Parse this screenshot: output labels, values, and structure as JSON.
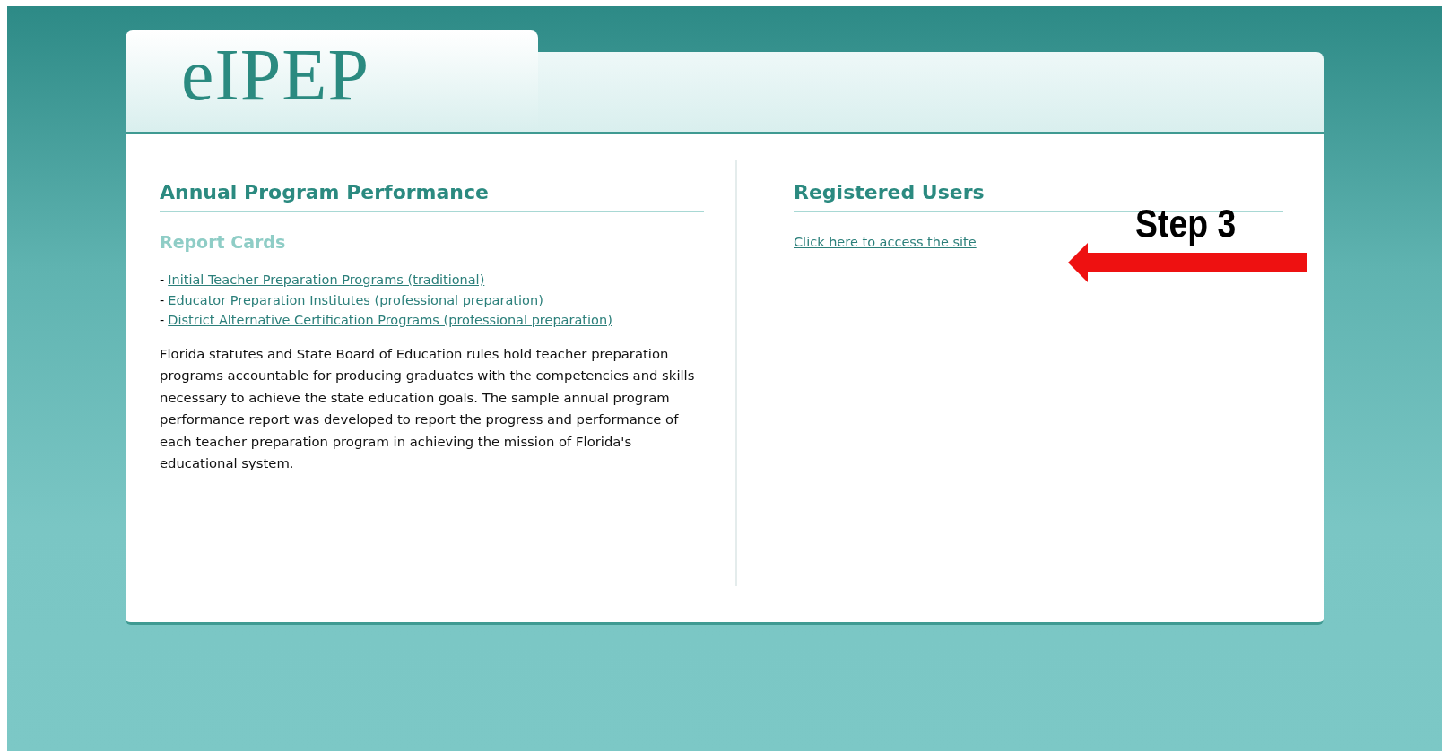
{
  "logo": "eIPEP",
  "left": {
    "heading": "Annual Program Performance",
    "subheading": "Report Cards",
    "links": [
      {
        "prefix": "-",
        "label": "Initial Teacher Preparation Programs (traditional)"
      },
      {
        "prefix": "-",
        "label": "Educator Preparation Institutes (professional preparation)"
      },
      {
        "prefix": "-",
        "label": "District Alternative Certification Programs (professional preparation)"
      }
    ],
    "paragraph": "Florida statutes and State Board of Education rules hold teacher preparation programs accountable for producing graduates with the competencies and skills necessary to achieve the state education goals. The sample annual program performance report was developed to report the progress and performance of each teacher preparation program in achieving the mission of Florida's educational system."
  },
  "right": {
    "heading": "Registered Users",
    "link": "Click here to access the site"
  },
  "annotation": {
    "label": "Step 3"
  }
}
